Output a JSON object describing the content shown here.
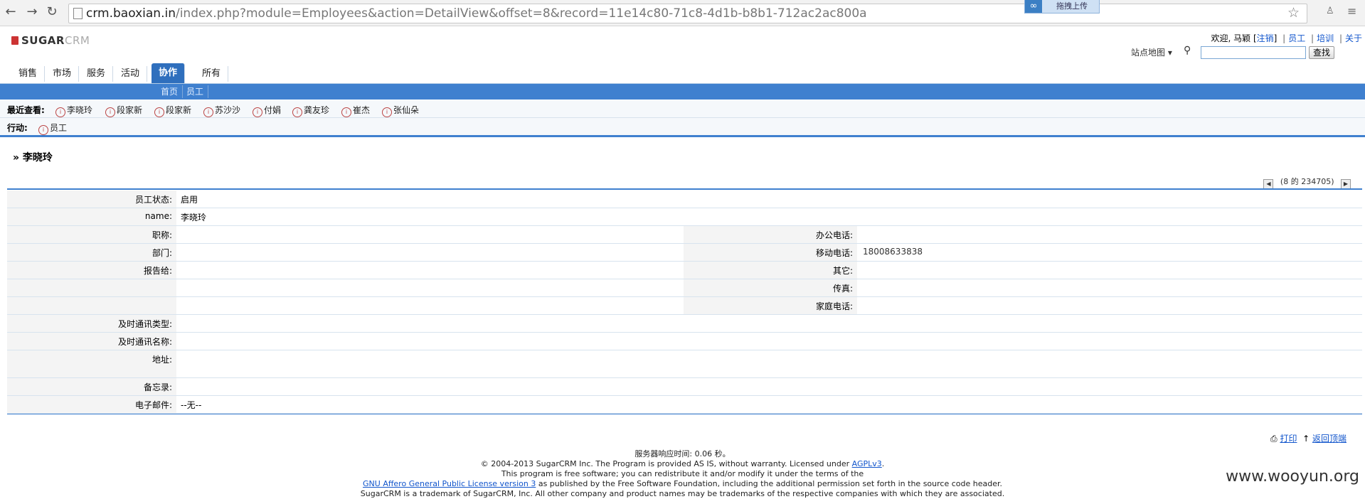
{
  "browser": {
    "url_host": "crm.baoxian.in",
    "url_rest": "/index.php?module=Employees&action=DetailView&offset=8&record=11e14c80-71c8-4d1b-b8b1-712ac2ac800a",
    "upload_label": "拖拽上传"
  },
  "header": {
    "logo_sugar": "SUGAR",
    "logo_crm": "CRM",
    "welcome": "欢迎, 马颖",
    "logout": "注销",
    "links": [
      "员工",
      "培训",
      "关于"
    ],
    "sitemap": "站点地图",
    "search_button": "查找"
  },
  "tabs": [
    "销售",
    "市场",
    "服务",
    "活动",
    "协作",
    "所有"
  ],
  "subtabs": [
    "首页",
    "员工"
  ],
  "recent": {
    "label": "最近查看:",
    "items": [
      "李晓玲",
      "段家新",
      "段家新",
      "苏沙沙",
      "付娟",
      "龚友珍",
      "崔杰",
      "张仙朵"
    ]
  },
  "actions": {
    "label": "行动:",
    "item": "员工"
  },
  "record": {
    "title": "李晓玲",
    "pager": "(8 的 234705)"
  },
  "fields": {
    "status_label": "员工状态:",
    "status_value": "启用",
    "name_label": "name:",
    "name_value": "李晓玲",
    "title_label": "职称:",
    "office_phone_label": "办公电话:",
    "dept_label": "部门:",
    "mobile_label": "移动电话:",
    "mobile_value": "18008633838",
    "reports_label": "报告给:",
    "other_label": "其它:",
    "fax_label": "传真:",
    "home_phone_label": "家庭电话:",
    "im_type_label": "及时通讯类型:",
    "im_name_label": "及时通讯名称:",
    "address_label": "地址:",
    "notes_label": "备忘录:",
    "email_label": "电子邮件:",
    "email_value": "--无--"
  },
  "footer": {
    "print": "打印",
    "back_top": "返回顶端",
    "response_time": "服务器响应时间: 0.06 秒。",
    "line1_a": "© 2004-2013 SugarCRM Inc. The Program is provided AS IS, without warranty. Licensed under ",
    "line1_link": "AGPLv3",
    "line2": "This program is free software; you can redistribute it and/or modify it under the terms of the",
    "line3_link": "GNU Affero General Public License version 3",
    "line3_b": " as published by the Free Software Foundation, including the additional permission set forth in the source code header.",
    "line4": "SugarCRM is a trademark of SugarCRM, Inc. All other company and product names may be trademarks of the respective companies with which they are associated.",
    "watermark": "www.wooyun.org"
  }
}
